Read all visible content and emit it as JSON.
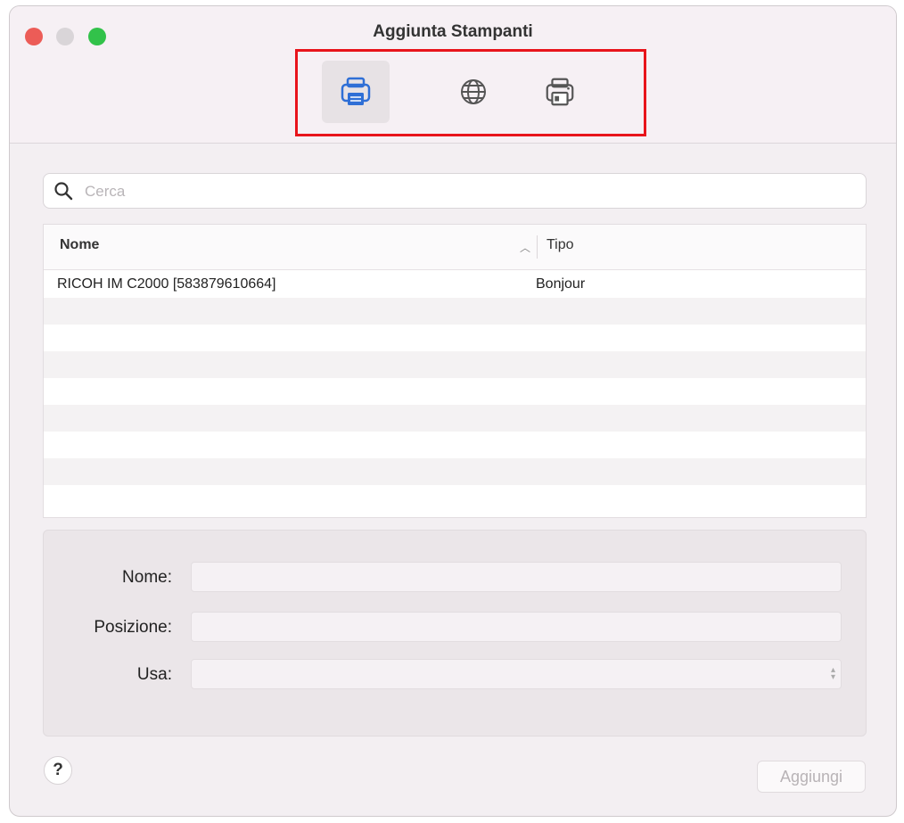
{
  "window": {
    "title": "Aggiunta Stampanti"
  },
  "toolbar": {
    "buttons": [
      {
        "icon": "printer-icon",
        "selected": true
      },
      {
        "icon": "globe-icon",
        "selected": false
      },
      {
        "icon": "printer-alt-icon",
        "selected": false
      }
    ]
  },
  "search": {
    "placeholder": "Cerca",
    "value": ""
  },
  "table": {
    "columns": [
      {
        "label": "Nome"
      },
      {
        "label": "Tipo"
      }
    ],
    "rows": [
      {
        "name": "RICOH IM C2000 [583879610664]",
        "type": "Bonjour"
      }
    ]
  },
  "form": {
    "name_label": "Nome:",
    "location_label": "Posizione:",
    "use_label": "Usa:"
  },
  "footer": {
    "help_label": "?",
    "add_label": "Aggiungi"
  },
  "colors": {
    "accent": "#2f6fd6",
    "highlight": "#e8141b"
  }
}
